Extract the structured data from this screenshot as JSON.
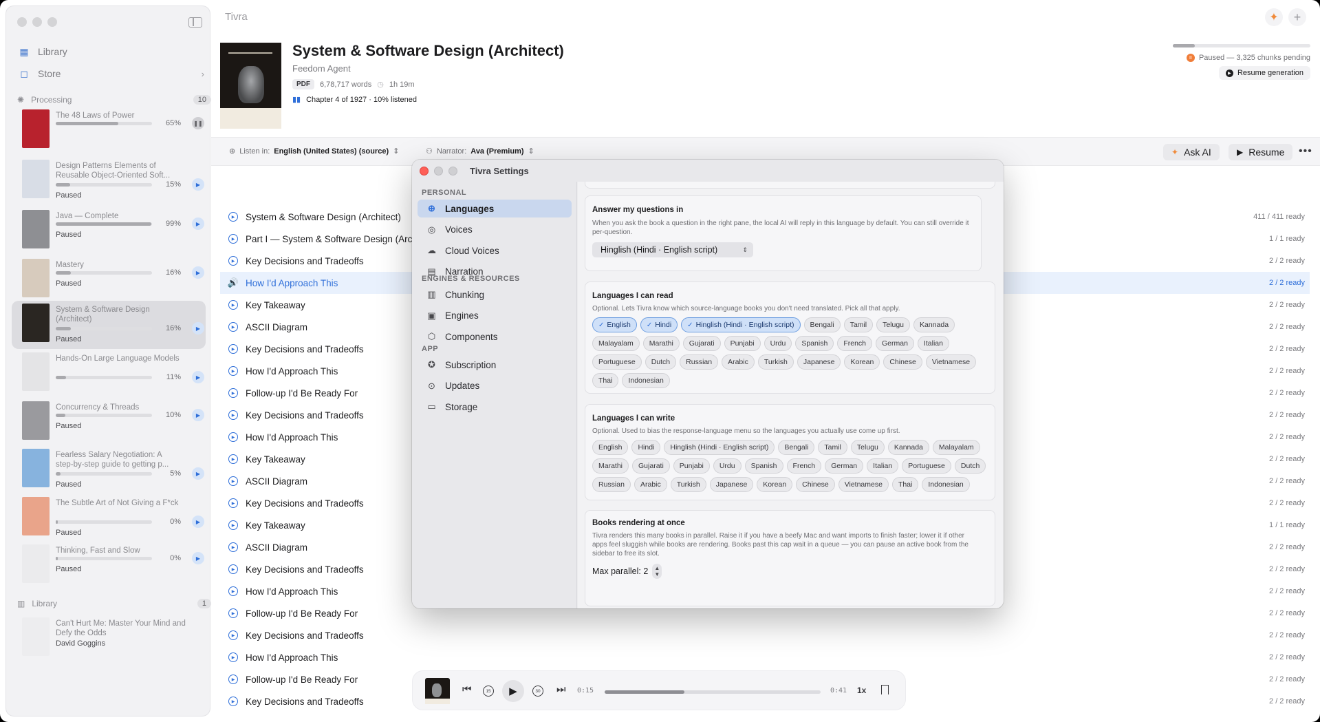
{
  "app": {
    "title": "Tivra"
  },
  "sidebar": {
    "nav": [
      {
        "label": "Library",
        "icon": "library-grid-icon"
      },
      {
        "label": "Store",
        "icon": "store-bag-icon"
      }
    ],
    "processing": {
      "label": "Processing",
      "count": "10"
    },
    "books": [
      {
        "title": "The 48 Laws of Power",
        "pct": "65%",
        "progress": 0.65,
        "status": "",
        "action": "pause",
        "cover": "#b8222d"
      },
      {
        "title": "Design Patterns Elements of Reusable Object-Oriented Soft...",
        "pct": "15%",
        "progress": 0.15,
        "status": "Paused",
        "action": "play",
        "cover": "#d8dde6"
      },
      {
        "title": "Java — Complete",
        "pct": "99%",
        "progress": 0.99,
        "status": "Paused",
        "action": "play",
        "cover": "#8e8f93"
      },
      {
        "title": "Mastery",
        "pct": "16%",
        "progress": 0.16,
        "status": "Paused",
        "action": "play",
        "cover": "#d7cbbd"
      },
      {
        "title": "System & Software Design (Architect)",
        "pct": "16%",
        "progress": 0.16,
        "status": "Paused",
        "action": "play",
        "cover": "#2a2622",
        "active": true
      },
      {
        "title": "Hands-On Large Language Models",
        "pct": "11%",
        "progress": 0.11,
        "status": "",
        "action": "play",
        "cover": "#e4e4e6"
      },
      {
        "title": "Concurrency & Threads",
        "pct": "10%",
        "progress": 0.1,
        "status": "Paused",
        "action": "play",
        "cover": "#9a9a9e"
      },
      {
        "title": "Fearless Salary Negotiation: A step-by-step guide to getting p...",
        "pct": "5%",
        "progress": 0.05,
        "status": "Paused",
        "action": "play",
        "cover": "#87b3de"
      },
      {
        "title": "The Subtle Art of Not Giving a F*ck",
        "pct": "0%",
        "progress": 0.01,
        "status": "Paused",
        "action": "play",
        "cover": "#e9a48a"
      },
      {
        "title": "Thinking, Fast and Slow",
        "pct": "0%",
        "progress": 0.01,
        "status": "Paused",
        "action": "play",
        "cover": "#ebebed"
      }
    ],
    "library": {
      "label": "Library",
      "count": "1"
    },
    "library_book": {
      "title": "Can't Hurt Me: Master Your Mind and Defy the Odds",
      "author": "David Goggins"
    }
  },
  "book": {
    "title": "System & Software Design (Architect)",
    "author": "Feedom Agent",
    "format": "PDF",
    "words": "6,78,717 words",
    "duration": "1h 19m",
    "chapter": "Chapter 4 of 1927 · 10% listened",
    "generation_status": "Paused — 3,325 chunks pending",
    "generation_progress": 0.16,
    "resume_generation": "Resume generation"
  },
  "toolbar": {
    "listen_label": "Listen in:",
    "listen_value": "English (United States)  (source)",
    "narrator_label": "Narrator:",
    "narrator_value": "Ava (Premium)",
    "ask_ai": "Ask AI",
    "resume": "Resume",
    "more": "•••"
  },
  "chapters": [
    {
      "title": "System & Software Design (Architect)",
      "ready": "411 / 411 ready"
    },
    {
      "title": "Part I — System & Software Design (Architect)",
      "ready": "1 / 1 ready"
    },
    {
      "title": "Key Decisions and Tradeoffs",
      "ready": "2 / 2 ready"
    },
    {
      "title": "How I'd Approach This",
      "ready": "2 / 2 ready",
      "current": true
    },
    {
      "title": "Key Takeaway",
      "ready": "2 / 2 ready"
    },
    {
      "title": "ASCII Diagram",
      "ready": "2 / 2 ready"
    },
    {
      "title": "Key Decisions and Tradeoffs",
      "ready": "2 / 2 ready"
    },
    {
      "title": "How I'd Approach This",
      "ready": "2 / 2 ready"
    },
    {
      "title": "Follow-up I'd Be Ready For",
      "ready": "2 / 2 ready"
    },
    {
      "title": "Key Decisions and Tradeoffs",
      "ready": "2 / 2 ready"
    },
    {
      "title": "How I'd Approach This",
      "ready": "2 / 2 ready"
    },
    {
      "title": "Key Takeaway",
      "ready": "2 / 2 ready"
    },
    {
      "title": "ASCII Diagram",
      "ready": "2 / 2 ready"
    },
    {
      "title": "Key Decisions and Tradeoffs",
      "ready": "2 / 2 ready"
    },
    {
      "title": "Key Takeaway",
      "ready": "1 / 1 ready"
    },
    {
      "title": "ASCII Diagram",
      "ready": "2 / 2 ready"
    },
    {
      "title": "Key Decisions and Tradeoffs",
      "ready": "2 / 2 ready"
    },
    {
      "title": "How I'd Approach This",
      "ready": "2 / 2 ready"
    },
    {
      "title": "Follow-up I'd Be Ready For",
      "ready": "2 / 2 ready"
    },
    {
      "title": "Key Decisions and Tradeoffs",
      "ready": "2 / 2 ready"
    },
    {
      "title": "How I'd Approach This",
      "ready": "2 / 2 ready"
    },
    {
      "title": "Follow-up I'd Be Ready For",
      "ready": "2 / 2 ready"
    },
    {
      "title": "Key Decisions and Tradeoffs",
      "ready": "2 / 2 ready"
    }
  ],
  "player": {
    "elapsed": "0:15",
    "remaining": "0:41",
    "progress": 0.37,
    "rate": "1x",
    "skip_back": "15",
    "skip_forward": "30"
  },
  "settings": {
    "title": "Tivra Settings",
    "groups": [
      {
        "label": "PERSONAL",
        "items": [
          {
            "label": "Languages",
            "icon": "globe-icon",
            "active": true
          },
          {
            "label": "Voices",
            "icon": "voices-icon"
          },
          {
            "label": "Cloud Voices",
            "icon": "cloud-icon"
          },
          {
            "label": "Narration",
            "icon": "book-icon"
          }
        ]
      },
      {
        "label": "ENGINES & RESOURCES",
        "items": [
          {
            "label": "Chunking",
            "icon": "chunking-icon"
          },
          {
            "label": "Engines",
            "icon": "cpu-icon"
          },
          {
            "label": "Components",
            "icon": "cube-icon"
          }
        ]
      },
      {
        "label": "APP",
        "items": [
          {
            "label": "Subscription",
            "icon": "star-badge-icon"
          },
          {
            "label": "Updates",
            "icon": "download-icon"
          },
          {
            "label": "Storage",
            "icon": "disk-icon"
          }
        ]
      }
    ],
    "answer": {
      "title": "Answer my questions in",
      "desc": "When you ask the book a question in the right pane, the local AI will reply in this language by default. You can still override it per-question.",
      "value": "Hinglish (Hindi · English script)"
    },
    "read": {
      "title": "Languages I can read",
      "desc": "Optional. Lets Tivra know which source-language books you don't need translated. Pick all that apply.",
      "selected": [
        "English",
        "Hindi",
        "Hinglish (Hindi · English script)"
      ],
      "options": [
        "Bengali",
        "Tamil",
        "Telugu",
        "Kannada",
        "Malayalam",
        "Marathi",
        "Gujarati",
        "Punjabi",
        "Urdu",
        "Spanish",
        "French",
        "German",
        "Italian",
        "Portuguese",
        "Dutch",
        "Russian",
        "Arabic",
        "Turkish",
        "Japanese",
        "Korean",
        "Chinese",
        "Vietnamese",
        "Thai",
        "Indonesian"
      ]
    },
    "write": {
      "title": "Languages I can write",
      "desc": "Optional. Used to bias the response-language menu so the languages you actually use come up first.",
      "options": [
        "English",
        "Hindi",
        "Hinglish (Hindi · English script)",
        "Bengali",
        "Tamil",
        "Telugu",
        "Kannada",
        "Malayalam",
        "Marathi",
        "Gujarati",
        "Punjabi",
        "Urdu",
        "Spanish",
        "French",
        "German",
        "Italian",
        "Portuguese",
        "Dutch",
        "Russian",
        "Arabic",
        "Turkish",
        "Japanese",
        "Korean",
        "Chinese",
        "Vietnamese",
        "Thai",
        "Indonesian"
      ]
    },
    "parallel": {
      "title": "Books rendering at once",
      "desc": "Tivra renders this many books in parallel. Raise it if you have a beefy Mac and want imports to finish faster; lower it if other apps feel sluggish while books are rendering. Books past this cap wait in a queue — you can pause an active book from the sidebar to free its slot.",
      "value": "Max parallel: 2"
    }
  }
}
